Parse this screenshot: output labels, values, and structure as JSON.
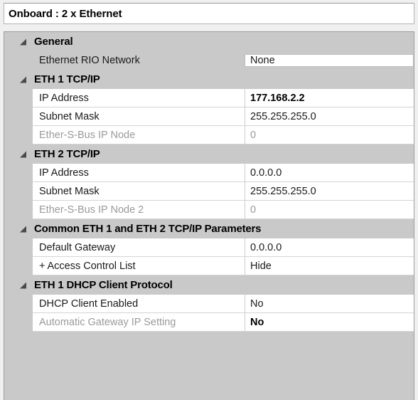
{
  "window": {
    "title": "Onboard : 2 x Ethernet"
  },
  "grid": {
    "expander_icon": "triangle-expanded-icon",
    "sections": [
      {
        "id": "general",
        "header": "General",
        "rows": [
          {
            "label": "Ethernet RIO Network",
            "value": "None",
            "label_style": "gray",
            "value_style": "boxed",
            "disabled": false,
            "bold_value": false
          }
        ]
      },
      {
        "id": "eth1-tcpip",
        "header": "ETH 1 TCP/IP",
        "rows": [
          {
            "label": "IP Address",
            "value": "177.168.2.2",
            "label_style": "white",
            "value_style": "plain",
            "disabled": false,
            "bold_value": true
          },
          {
            "label": "Subnet Mask",
            "value": "255.255.255.0",
            "label_style": "white",
            "value_style": "plain",
            "disabled": false,
            "bold_value": false
          },
          {
            "label": "Ether-S-Bus IP Node",
            "value": "0",
            "label_style": "white",
            "value_style": "plain",
            "disabled": true,
            "bold_value": false
          }
        ]
      },
      {
        "id": "eth2-tcpip",
        "header": "ETH 2 TCP/IP",
        "rows": [
          {
            "label": "IP Address",
            "value": "0.0.0.0",
            "label_style": "white",
            "value_style": "plain",
            "disabled": false,
            "bold_value": false
          },
          {
            "label": "Subnet Mask",
            "value": "255.255.255.0",
            "label_style": "white",
            "value_style": "plain",
            "disabled": false,
            "bold_value": false
          },
          {
            "label": "Ether-S-Bus IP Node 2",
            "value": "0",
            "label_style": "white",
            "value_style": "plain",
            "disabled": true,
            "bold_value": false
          }
        ]
      },
      {
        "id": "common-params",
        "header": "Common ETH 1 and ETH 2 TCP/IP Parameters",
        "rows": [
          {
            "label": "Default Gateway",
            "value": "0.0.0.0",
            "label_style": "white",
            "value_style": "plain",
            "disabled": false,
            "bold_value": false
          },
          {
            "label": "Access Control List",
            "label_prefix": "+",
            "value": "Hide",
            "label_style": "white",
            "value_style": "plain",
            "disabled": false,
            "bold_value": false,
            "expandable": true
          }
        ]
      },
      {
        "id": "eth1-dhcp",
        "header": "ETH 1 DHCP Client Protocol",
        "rows": [
          {
            "label": "DHCP Client Enabled",
            "value": "No",
            "label_style": "white",
            "value_style": "plain",
            "disabled": false,
            "bold_value": false
          },
          {
            "label": "Automatic Gateway IP Setting",
            "value": "No",
            "label_style": "white",
            "value_style": "plain",
            "disabled": true,
            "bold_value": true
          }
        ]
      }
    ]
  },
  "colors": {
    "panel_gray": "#c9c9c9",
    "row_white": "#ffffff",
    "border": "#9e9e9e",
    "disabled_text": "#9a9a9a",
    "outer_bg": "#f0f0f0"
  }
}
